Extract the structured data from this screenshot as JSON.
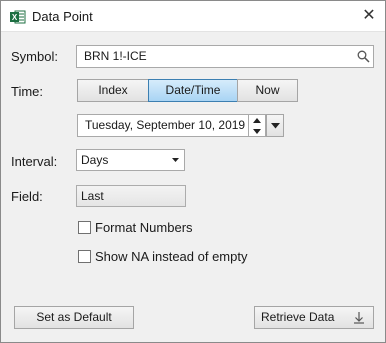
{
  "window": {
    "title": "Data Point",
    "close_glyph": "✕",
    "app_icon": "excel-icon",
    "app_icon_letter": "X",
    "app_icon_color": "#1d6f42"
  },
  "form": {
    "symbol": {
      "label": "Symbol:",
      "value": "BRN 1!-ICE",
      "icon": "search-icon"
    },
    "time": {
      "label": "Time:",
      "options": [
        "Index",
        "Date/Time",
        "Now"
      ],
      "selected": "Date/Time",
      "date_value": "Tuesday, September 10, 2019"
    },
    "interval": {
      "label": "Interval:",
      "value": "Days"
    },
    "field": {
      "label": "Field:",
      "value": "Last"
    },
    "format_numbers": {
      "label": "Format Numbers",
      "checked": false
    },
    "show_na": {
      "label": "Show NA instead of empty",
      "checked": false
    }
  },
  "actions": {
    "set_default": "Set as Default",
    "retrieve": "Retrieve Data",
    "retrieve_icon": "download-arrow-icon"
  },
  "colors": {
    "selected_segment": "#a9d4f4",
    "selected_border": "#3c7fb1",
    "dialog_bg": "#f0f0f0"
  }
}
